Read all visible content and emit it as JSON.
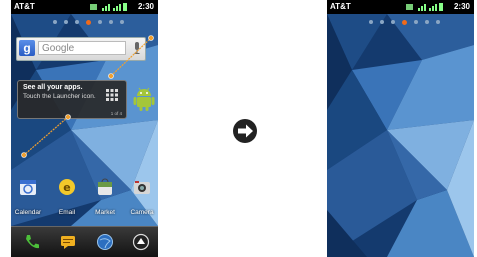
{
  "left_screen": {
    "status": {
      "carrier": "AT&T",
      "time": "2:30"
    },
    "search": {
      "logo": "g",
      "placeholder": "Google"
    },
    "tip": {
      "title": "See all your apps.",
      "body": "Touch the Launcher icon.",
      "page": "1 of 4"
    },
    "apps": [
      {
        "label": "Calendar",
        "icon": "calendar-icon",
        "color": "#3a6fd0"
      },
      {
        "label": "Email",
        "icon": "email-icon",
        "color": "#e0b020"
      },
      {
        "label": "Market",
        "icon": "market-icon",
        "color": "#5a8a3a"
      },
      {
        "label": "Camera",
        "icon": "camera-icon",
        "color": "#333333"
      }
    ],
    "dock": [
      "phone-icon",
      "messaging-icon",
      "browser-icon",
      "launcher-icon"
    ]
  },
  "right_screen": {
    "status": {
      "carrier": "AT&T",
      "time": "2:30"
    }
  },
  "arrow": {
    "icon": "arrow-right-icon"
  },
  "colors": {
    "accent_orange": "#f06a1a",
    "android_green": "#a4c639",
    "callout_orange": "#f0a030"
  }
}
